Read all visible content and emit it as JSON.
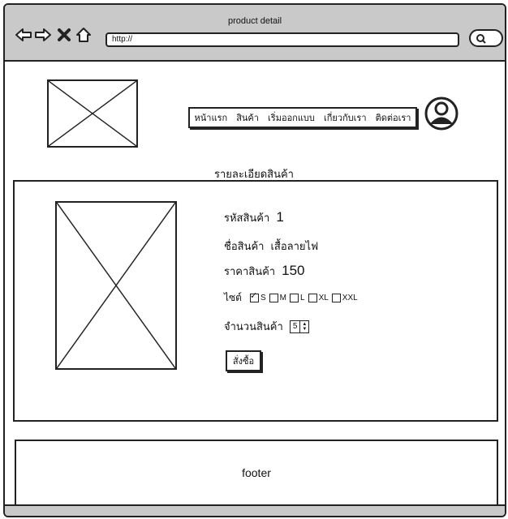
{
  "window": {
    "title": "product detail",
    "address": "http://"
  },
  "header": {
    "nav": [
      "หน้าแรก",
      "สินค้า",
      "เริ่มออกแบบ",
      "เกี่ยวกับเรา",
      "ติดต่อเรา"
    ]
  },
  "main": {
    "section_title": "รายละเอียดสินค้า",
    "product": {
      "code_label": "รหัสสินค้า",
      "code_value": "1",
      "name_label": "ชื่อสินค้า",
      "name_value": "เสื้อลายไฟ",
      "price_label": "ราคาสินค้า",
      "price_value": "150",
      "size_label": "ไซต์",
      "sizes": [
        "S",
        "M",
        "L",
        "XL",
        "XXL"
      ],
      "selected_size": "S",
      "qty_label": "จำนวนสินค้า",
      "qty_value": "5",
      "order_button": "สั่งซื้อ"
    }
  },
  "footer": {
    "text": "footer"
  }
}
